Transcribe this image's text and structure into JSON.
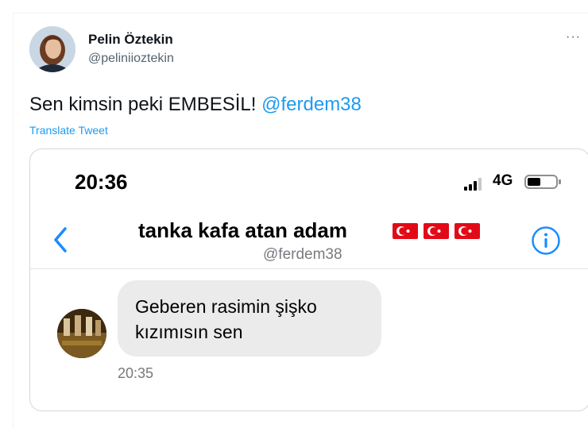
{
  "author": {
    "display_name": "Pelin Öztekin",
    "handle": "@peliniioztekin"
  },
  "more_label": "···",
  "tweet": {
    "text": "Sen kimsin peki EMBESİL! ",
    "mention": "@ferdem38",
    "translate_label": "Translate Tweet"
  },
  "screenshot": {
    "status_time": "20:36",
    "network": "4G",
    "contact_name": "tanka kafa atan adam",
    "contact_handle": "@ferdem38",
    "message_text": "Geberen rasimin şişko kızımısın sen",
    "message_time": "20:35"
  },
  "colors": {
    "accent": "#1d9bf0",
    "ios_blue": "#1a8cff",
    "bubble": "#ebebeb",
    "flag_red": "#e30a17"
  },
  "icons": {
    "more": "more-horizontal-icon",
    "back": "chevron-left-icon",
    "info": "info-circle-icon",
    "signal": "cellular-signal-icon",
    "battery": "battery-icon",
    "flag": "turkey-flag-icon"
  }
}
